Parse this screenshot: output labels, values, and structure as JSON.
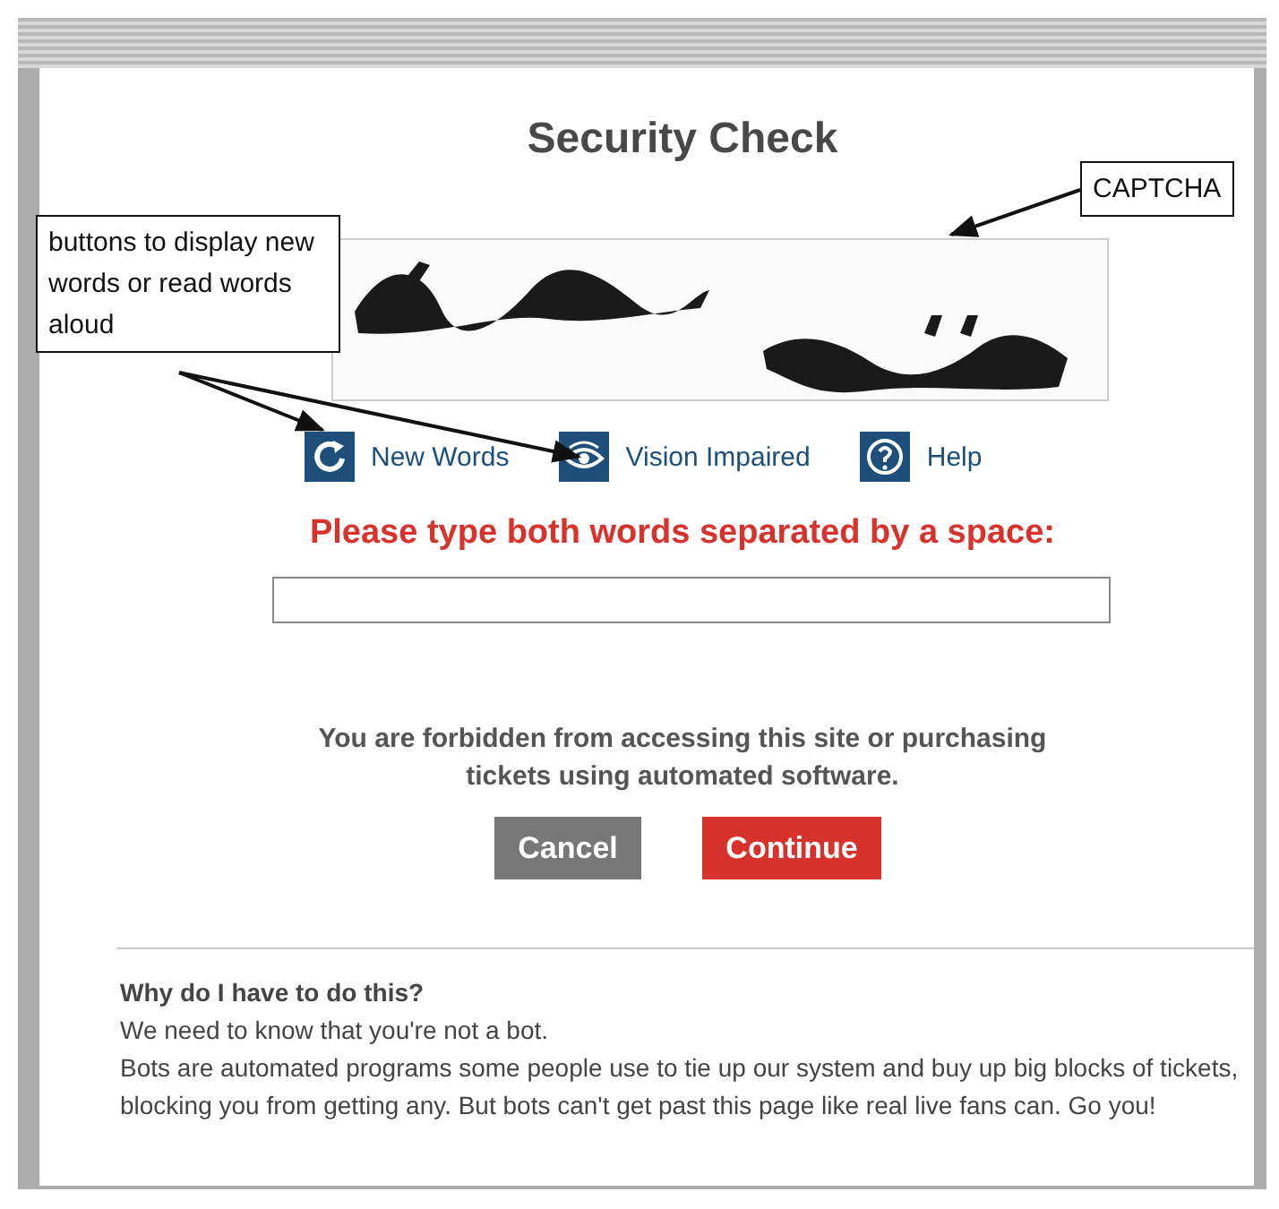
{
  "page": {
    "title": "Security Check",
    "actions": [
      {
        "label": "New Words",
        "kind": "refresh"
      },
      {
        "label": "Vision Impaired",
        "kind": "eye"
      },
      {
        "label": "Help",
        "kind": "help"
      }
    ],
    "prompt": "Please type both words separated by a space:",
    "notice": "You are forbidden from accessing this site or purchasing tickets using automated software.",
    "buttons": [
      {
        "label": "Cancel",
        "kind": "secondary"
      },
      {
        "label": "Continue",
        "kind": "primary"
      }
    ],
    "help": {
      "heading": "Why do I have to do this?",
      "lines": [
        "We need to know that you're not a bot.",
        "Bots are automated programs some people use to tie up our system and buy up big blocks of tickets, blocking you from getting any. But bots can't get past this page like real live fans can. Go you!"
      ]
    }
  },
  "annotations": [
    {
      "text": "CAPTCHA",
      "kind": "captcha"
    },
    {
      "text": "buttons to display new words or read words aloud",
      "kind": "buttons"
    }
  ]
}
